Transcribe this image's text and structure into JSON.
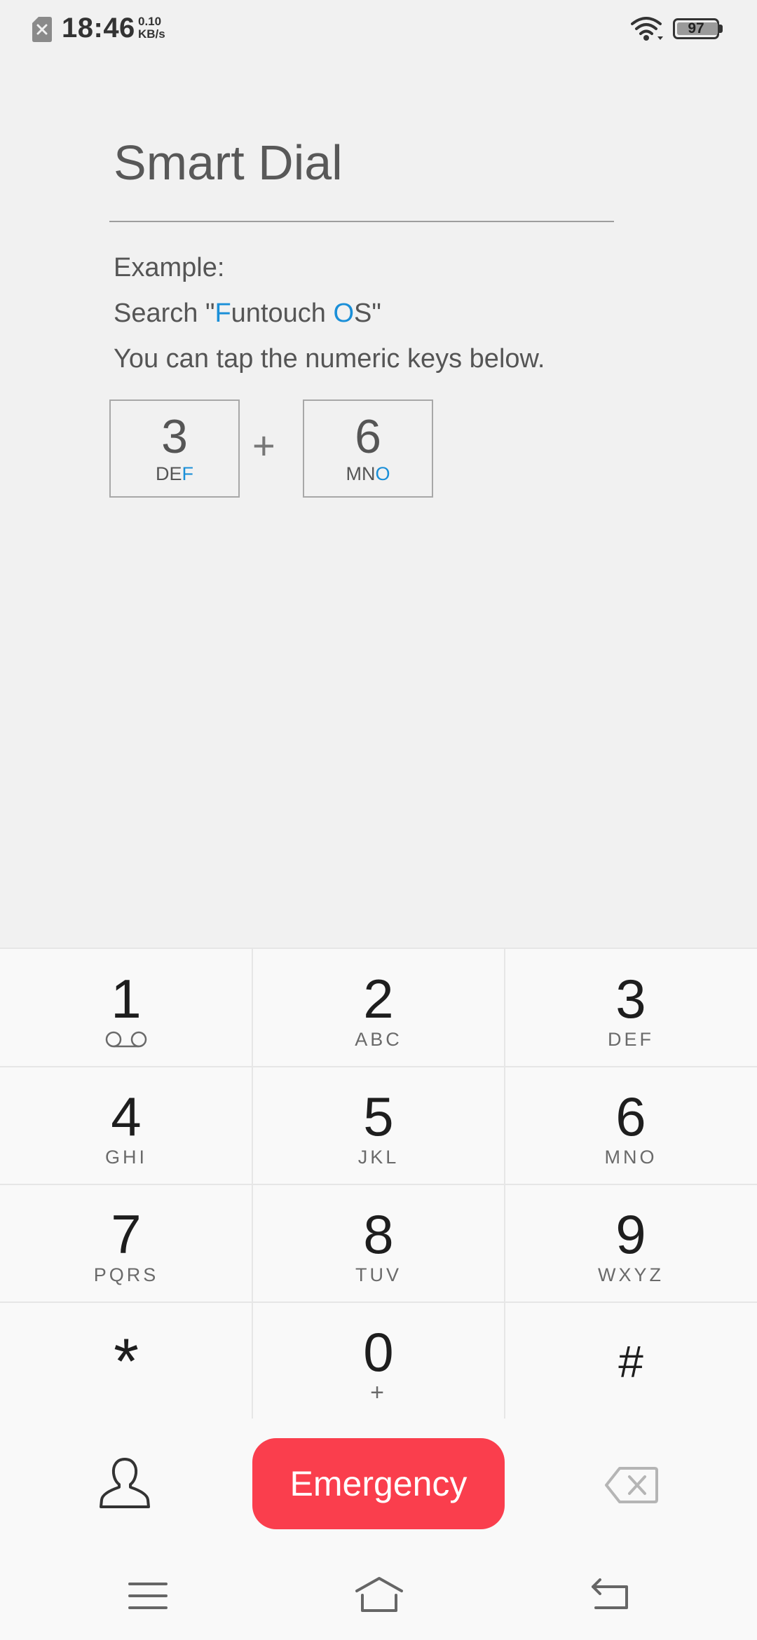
{
  "status_bar": {
    "time": "18:46",
    "net_speed_value": "0.10",
    "net_speed_unit": "KB/s",
    "battery_level": "97",
    "icons": [
      "sim-error-icon",
      "wifi-icon",
      "battery-icon"
    ]
  },
  "hint": {
    "title": "Smart Dial",
    "example_label": "Example:",
    "search_prefix": "Search \"",
    "search_hl1": "F",
    "search_mid": "untouch ",
    "search_hl2": "O",
    "search_suffix": "S\"",
    "instruction": "You can tap the numeric keys below.",
    "example_keys": [
      {
        "digit": "3",
        "letters_plain": "DE",
        "letters_hl": "F"
      },
      {
        "digit": "6",
        "letters_plain": "MN",
        "letters_hl": "O"
      }
    ],
    "separator": "+",
    "highlight_color": "#1a8fd8"
  },
  "dialpad": {
    "keys": [
      {
        "digit": "1",
        "letters": ""
      },
      {
        "digit": "2",
        "letters": "ABC"
      },
      {
        "digit": "3",
        "letters": "DEF"
      },
      {
        "digit": "4",
        "letters": "GHI"
      },
      {
        "digit": "5",
        "letters": "JKL"
      },
      {
        "digit": "6",
        "letters": "MNO"
      },
      {
        "digit": "7",
        "letters": "PQRS"
      },
      {
        "digit": "8",
        "letters": "TUV"
      },
      {
        "digit": "9",
        "letters": "WXYZ"
      },
      {
        "digit": "*",
        "letters": ""
      },
      {
        "digit": "0",
        "letters": "+"
      },
      {
        "digit": "#",
        "letters": ""
      }
    ],
    "voicemail_icon": "voicemail-icon"
  },
  "actions": {
    "contacts_icon": "contacts-icon",
    "emergency_label": "Emergency",
    "emergency_color": "#fa3e4d",
    "backspace_icon": "backspace-icon"
  },
  "nav_bar": {
    "icons": [
      "menu-icon",
      "home-icon",
      "back-icon"
    ]
  }
}
